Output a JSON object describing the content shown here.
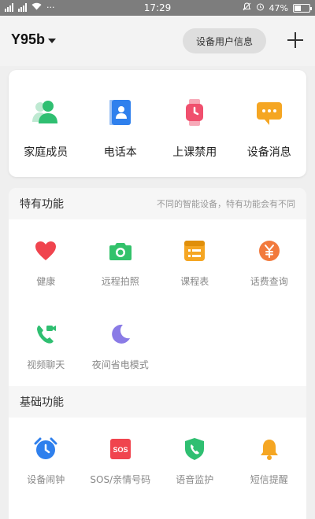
{
  "status_bar": {
    "network_left": "2G",
    "network_right": "4G",
    "time": "17:29",
    "battery": "47%",
    "battery_level": 0.47
  },
  "header": {
    "device_name": "Y95b",
    "info_button": "设备用户信息"
  },
  "quick_actions": [
    {
      "label": "家庭成员",
      "icon": "family-members-icon",
      "color": "#2fbf71"
    },
    {
      "label": "电话本",
      "icon": "phonebook-icon",
      "color": "#2f80ed"
    },
    {
      "label": "上课禁用",
      "icon": "class-disable-watch-icon",
      "color": "#f0506e"
    },
    {
      "label": "设备消息",
      "icon": "device-message-icon",
      "color": "#f5a623"
    }
  ],
  "special": {
    "title": "特有功能",
    "note": "不同的智能设备，特有功能会有不同",
    "items": [
      {
        "label": "健康",
        "icon": "heart-icon",
        "color": "#f0444e"
      },
      {
        "label": "远程拍照",
        "icon": "camera-icon",
        "color": "#33c26b"
      },
      {
        "label": "课程表",
        "icon": "schedule-icon",
        "color": "#f5a623"
      },
      {
        "label": "话费查询",
        "icon": "yuan-icon",
        "color": "#f27a3c"
      },
      {
        "label": "视频聊天",
        "icon": "video-call-icon",
        "color": "#2fbf71"
      },
      {
        "label": "夜间省电模式",
        "icon": "moon-icon",
        "color": "#8a7be6"
      }
    ]
  },
  "basic": {
    "title": "基础功能",
    "items": [
      {
        "label": "设备闹钟",
        "icon": "alarm-clock-icon",
        "color": "#2f80ed"
      },
      {
        "label": "SOS/亲情号码",
        "icon": "sos-icon",
        "color": "#f0444e",
        "badge": "SOS"
      },
      {
        "label": "语音监护",
        "icon": "voice-monitor-icon",
        "color": "#2fbf71"
      },
      {
        "label": "短信提醒",
        "icon": "bell-icon",
        "color": "#f5a623"
      }
    ]
  }
}
